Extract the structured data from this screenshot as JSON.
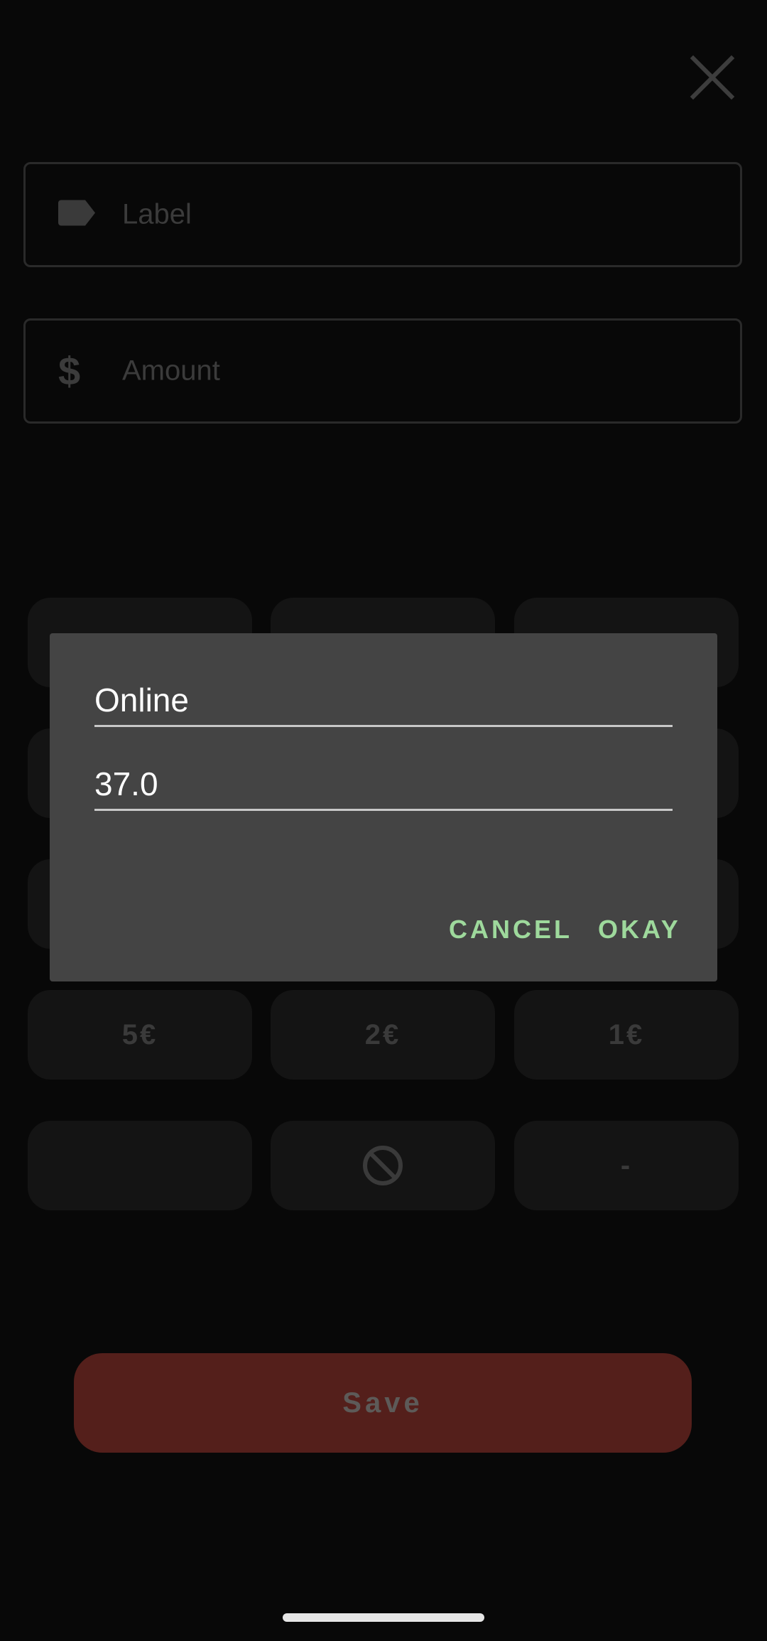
{
  "form": {
    "close_icon": "close-icon",
    "label_field": {
      "icon": "label-tag-icon",
      "placeholder": "Label"
    },
    "amount_field": {
      "icon": "dollar-icon",
      "icon_glyph": "$",
      "placeholder": "Amount"
    }
  },
  "keypad": {
    "row4": [
      "5€",
      "2€",
      "1€"
    ],
    "row5": {
      "middle_icon": "block-icon",
      "right_label": "-"
    }
  },
  "save_label": "Save",
  "dialog": {
    "name_value": "Online",
    "amount_value": "37.0",
    "cancel_label": "CANCEL",
    "okay_label": "OKAY"
  },
  "colors": {
    "background": "#080808",
    "dialog_bg": "#444444",
    "accent_green": "#9ed99c",
    "save_button": "#541f1b"
  }
}
